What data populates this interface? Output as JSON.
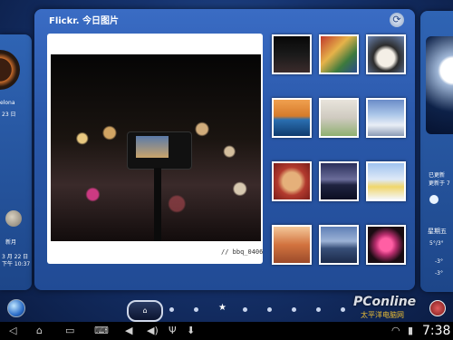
{
  "widget": {
    "title": "Flickr. 今日图片",
    "caption": "// bbq_0406"
  },
  "left_panel": {
    "city": "elona",
    "date_num": "23 日",
    "moon_label": "新月",
    "lines": [
      "3 月 22 日",
      "下午 10:37"
    ]
  },
  "right_panel": {
    "weekday": "星期五",
    "labels": [
      "已更新",
      "更新于 7"
    ],
    "temps": [
      "5°/3°",
      "-3°",
      "-3°"
    ]
  },
  "nav": {
    "home_label": "⌂"
  },
  "status_bar": {
    "time": "7:38"
  },
  "watermark": {
    "brand": "PConline",
    "sub": "太平洋电脑网"
  }
}
